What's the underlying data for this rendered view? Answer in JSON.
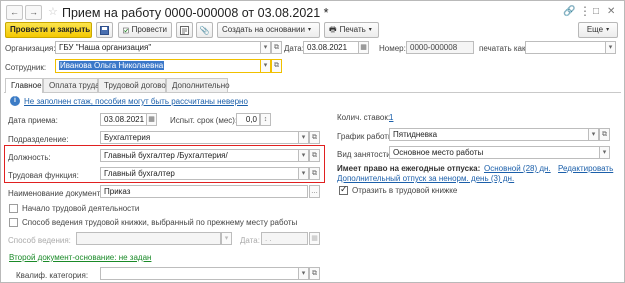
{
  "window": {
    "title": "Прием на работу 0000-000008 от 03.08.2021 *",
    "back_icon": "←",
    "forward_icon": "→"
  },
  "toolbar": {
    "post_and_close": "Провести и закрыть",
    "post": "Провести",
    "create_based_on": "Создать на основании",
    "print": "Печать"
  },
  "header": {
    "organization_label": "Организация:",
    "organization_value": "ГБУ \"Наша организация\"",
    "date_label": "Дата:",
    "date_value": "03.08.2021",
    "number_label": "Номер:",
    "number_value": "0000-000008",
    "print_as_label": "печатать как:",
    "employee_label": "Сотрудник:",
    "employee_value": "Иванова Ольга Николаевна"
  },
  "tabs": [
    {
      "label": "Главное",
      "active": true
    },
    {
      "label": "Оплата труда",
      "active": false
    },
    {
      "label": "Трудовой договор",
      "active": false
    },
    {
      "label": "Дополнительно",
      "active": false
    }
  ],
  "main": {
    "warning_link": "Не заполнен стаж, пособия могут быть рассчитаны неверно",
    "hire_date_label": "Дата приема:",
    "hire_date_value": "03.08.2021",
    "probation_label": "Испыт. срок (мес):",
    "probation_value": "0,0",
    "department_label": "Подразделение:",
    "department_value": "Бухгалтерия",
    "position_label": "Должность:",
    "position_value": "Главный бухгалтер /Бухгалтерия/",
    "labor_function_label": "Трудовая функция:",
    "labor_function_value": "Главный бухгалтер",
    "doc_name_label": "Наименование документа:",
    "doc_name_value": "Приказ",
    "chk_start_work": "Начало трудовой деятельности",
    "chk_keep_workbook": "Способ ведения трудовой книжки, выбранный по прежнему месту работы",
    "keep_method_label": "Способ ведения:",
    "keep_date_label": "Дата:",
    "keep_date_value": ". .",
    "second_basis_link": "Второй документ-основание: не задан",
    "qual_category_label": "Квалиф. категория:",
    "rates_label": "Колич. ставок:",
    "rates_value": "1",
    "schedule_label": "График работы:",
    "schedule_value": "Пятидневка",
    "employment_type_label": "Вид занятости:",
    "employment_type_value": "Основное место работы",
    "vacation_title": "Имеет право на ежегодные отпуска:",
    "vacation_main": "Основной (28) дн.",
    "vacation_edit": "Редактировать",
    "vacation_extra": "Дополнительный отпуск за ненорм. день (3) дн.",
    "chk_reflect_workbook": "Отразить в трудовой книжке"
  }
}
